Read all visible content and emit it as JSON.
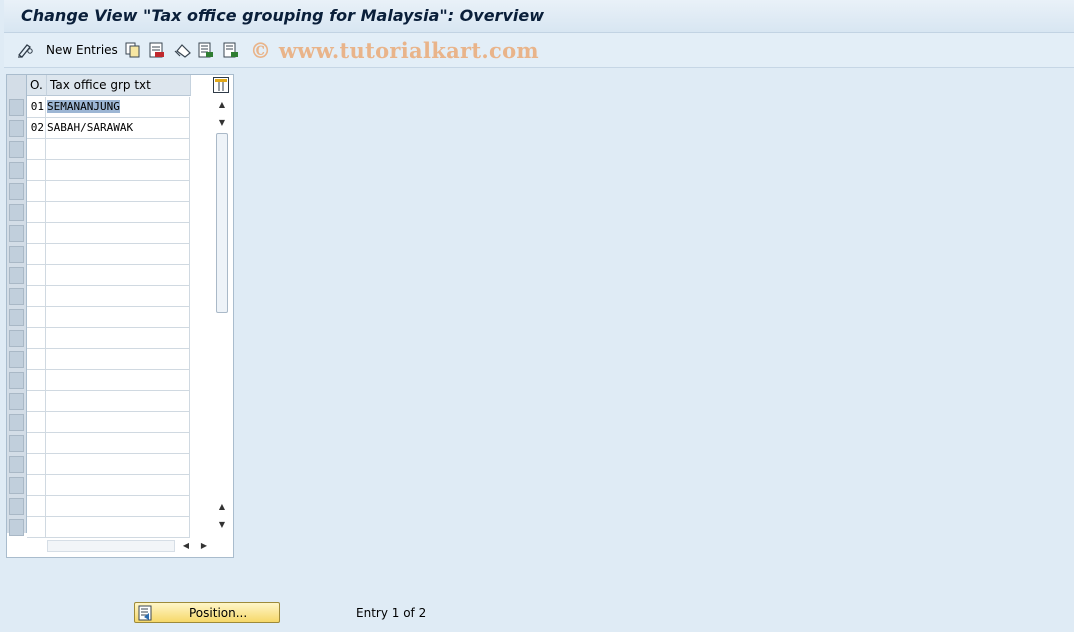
{
  "window": {
    "title": "Change View \"Tax office grouping for Malaysia\": Overview"
  },
  "toolbar": {
    "edit_icon": "pencil-glasses-icon",
    "new_entries_label": "New Entries",
    "icons": [
      "copy-icon",
      "delete-icon",
      "undo-icon",
      "select-all-icon",
      "deselect-icon"
    ],
    "watermark": "© www.tutorialkart.com"
  },
  "table": {
    "columns": [
      "O.",
      "Tax office grp txt"
    ],
    "rows": [
      {
        "code": "01",
        "text": "SEMANANJUNG",
        "highlighted": true
      },
      {
        "code": "02",
        "text": "SABAH/SARAWAK",
        "highlighted": false
      }
    ],
    "visible_row_count": 21,
    "column_settings_icon": "table-settings-icon"
  },
  "footer": {
    "position_button_label": "Position...",
    "position_icon": "position-icon",
    "entry_status": "Entry 1 of 2"
  },
  "colors": {
    "background": "#dfebf5",
    "highlight": "#9db6d4",
    "button": "#f6d86a"
  }
}
